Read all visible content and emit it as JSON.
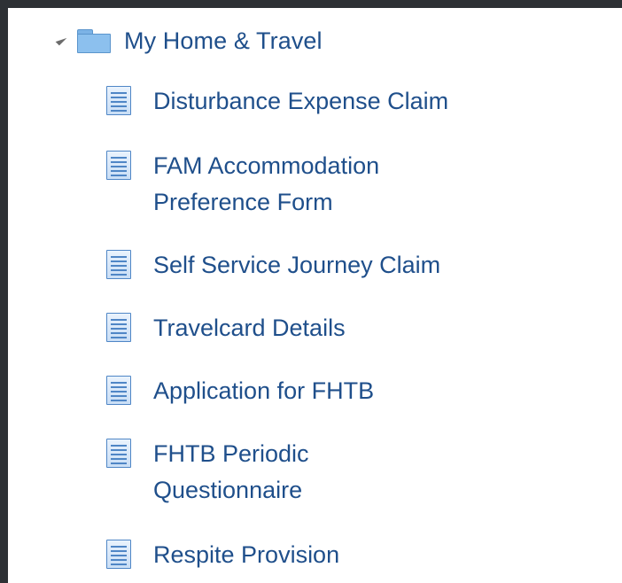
{
  "tree": {
    "root": {
      "label": "My Home & Travel",
      "expander_icon": "triangle-expanded-icon",
      "icon": "folder-icon"
    },
    "items": [
      {
        "label": "Disturbance Expense Claim",
        "icon": "document-icon"
      },
      {
        "label": "FAM Accommodation Preference Form",
        "icon": "document-icon"
      },
      {
        "label": "Self Service Journey Claim",
        "icon": "document-icon"
      },
      {
        "label": "Travelcard Details",
        "icon": "document-icon"
      },
      {
        "label": "Application for FHTB",
        "icon": "document-icon"
      },
      {
        "label": "FHTB Periodic Questionnaire",
        "icon": "document-icon"
      },
      {
        "label": "Respite Provision",
        "icon": "document-icon"
      }
    ]
  },
  "colors": {
    "link_text": "#1f4f8b",
    "icon_blue": "#4f86c6",
    "folder_blue": "#8cc0ee",
    "frame": "#2e3135",
    "panel": "#ffffff"
  }
}
